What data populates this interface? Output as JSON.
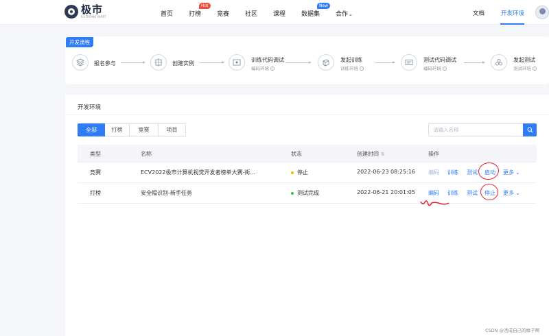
{
  "header": {
    "logo_text": "极市",
    "logo_sub": "EXTREME MART",
    "nav": [
      "首页",
      "打榜",
      "竞赛",
      "社区",
      "课程",
      "数据集",
      "合作"
    ],
    "hot_badge": "Hot",
    "new_badge": "New",
    "docs": "文档",
    "dev_env": "开发环境"
  },
  "flow": {
    "tag": "开发流程",
    "steps": [
      {
        "title": "报名参与",
        "sub": ""
      },
      {
        "title": "创建实例",
        "sub": ""
      },
      {
        "title": "训练代码调试",
        "sub": "编码环境"
      },
      {
        "title": "发起训练",
        "sub": "训练环境"
      },
      {
        "title": "测试代码调试",
        "sub": "编码环境"
      },
      {
        "title": "发起测试",
        "sub": "测试环境"
      }
    ]
  },
  "env": {
    "title": "开发环境",
    "tabs": [
      "全部",
      "打榜",
      "竞赛",
      "项目"
    ],
    "active_tab": 0,
    "search_placeholder": "请输入名称",
    "columns": [
      "类型",
      "名称",
      "状态",
      "创建时间",
      "操作"
    ],
    "rows": [
      {
        "type": "竞赛",
        "name": "ECV2022极市计算机视觉开发者榜单大赛-街...",
        "status": "停止",
        "status_color": "#f5b800",
        "created": "2022-06-23 08:25:16",
        "ops": [
          "编码",
          "训练",
          "测试",
          "启动",
          "更多"
        ]
      },
      {
        "type": "打榜",
        "name": "安全帽识别-新手任务",
        "status": "测试完成",
        "status_color": "#3cc23c",
        "created": "2022-06-21 20:01:05",
        "ops": [
          "编码",
          "训练",
          "测试",
          "停止",
          "更多"
        ]
      }
    ]
  },
  "watermark": "CSDN @活成自己的样子啊"
}
